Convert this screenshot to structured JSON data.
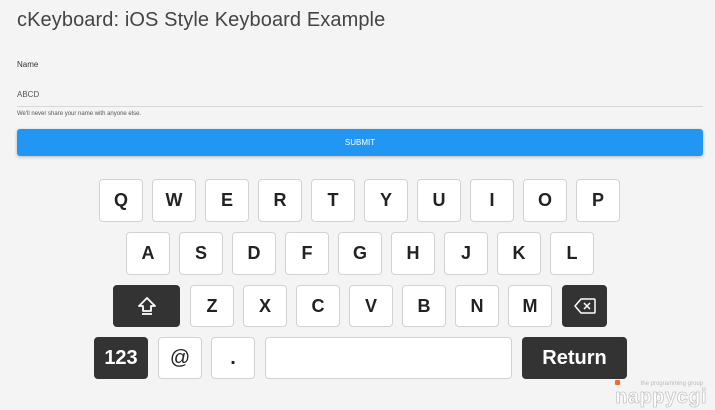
{
  "page": {
    "title": "cKeyboard: iOS Style Keyboard Example"
  },
  "form": {
    "name_label": "Name",
    "name_value": "ABCD",
    "help_text": "We'll never share your name with anyone else.",
    "submit_label": "SUBMIT",
    "accent_color": "#2196f3"
  },
  "keyboard": {
    "row1": [
      "Q",
      "W",
      "E",
      "R",
      "T",
      "Y",
      "U",
      "I",
      "O",
      "P"
    ],
    "row2": [
      "A",
      "S",
      "D",
      "F",
      "G",
      "H",
      "J",
      "K",
      "L"
    ],
    "row3": [
      "Z",
      "X",
      "C",
      "V",
      "B",
      "N",
      "M"
    ],
    "shift_icon": "shift-icon",
    "backspace_icon": "backspace-icon",
    "numbers_label": "123",
    "at_label": "@",
    "dot_label": ".",
    "space_label": "",
    "return_label": "Return"
  },
  "logo": {
    "tagline": "the programming group",
    "name": "nappycgi"
  }
}
